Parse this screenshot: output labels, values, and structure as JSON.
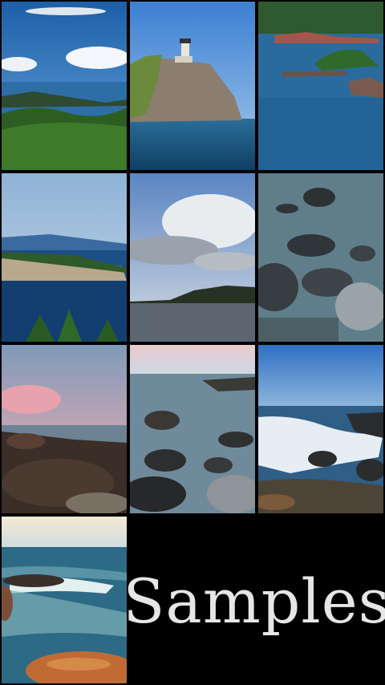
{
  "gallery": {
    "title": "Samples",
    "photos": [
      {
        "icon": "lake-shore-overlook-photo"
      },
      {
        "icon": "lighthouse-cliff-photo"
      },
      {
        "icon": "rocky-islands-bay-photo"
      },
      {
        "icon": "cliff-across-bay-photo"
      },
      {
        "icon": "cloudy-sky-over-lake-photo"
      },
      {
        "icon": "misty-rocks-water-photo"
      },
      {
        "icon": "pink-sunset-shore-photo"
      },
      {
        "icon": "long-exposure-rocks-photo"
      },
      {
        "icon": "crashing-waves-photo"
      },
      {
        "icon": "wave-rocks-foreground-photo"
      }
    ]
  },
  "colors": {
    "background": "#000000",
    "label": "#e6e6e6"
  }
}
